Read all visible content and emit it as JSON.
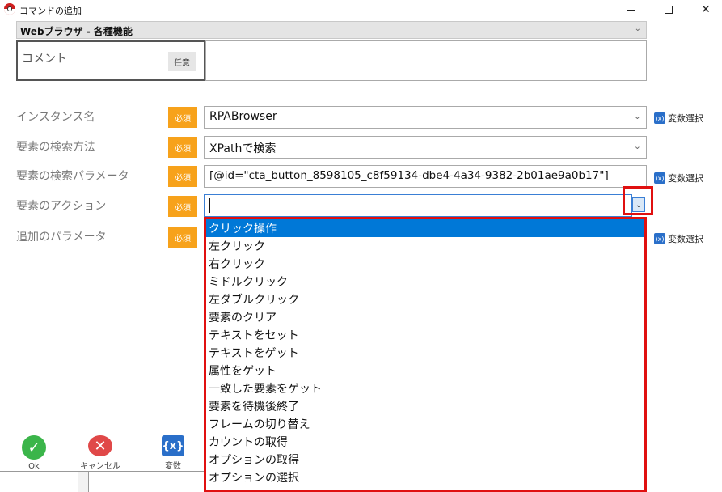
{
  "window": {
    "title": "コマンドの追加"
  },
  "category": {
    "value": "Webブラウザ - 各種機能"
  },
  "comment": {
    "label": "コメント",
    "badge": "任意",
    "value": ""
  },
  "badges": {
    "required": "必須"
  },
  "fields": {
    "instance": {
      "label": "インスタンス名",
      "value": "RPABrowser"
    },
    "search_method": {
      "label": "要素の検索方法",
      "value": "XPathで検索"
    },
    "search_param": {
      "label": "要素の検索パラメータ",
      "value": "[@id=\"cta_button_8598105_c8f59134-dbe4-4a34-9382-2b01ae9a0b17\"]"
    },
    "action": {
      "label": "要素のアクション",
      "value": ""
    },
    "extra_param": {
      "label": "追加のパラメータ"
    }
  },
  "var_select": {
    "label": "変数選択",
    "icon": "variable-icon"
  },
  "dropdown_options": [
    "クリック操作",
    "左クリック",
    "右クリック",
    "ミドルクリック",
    "左ダブルクリック",
    "要素のクリア",
    "テキストをセット",
    "テキストをゲット",
    "属性をゲット",
    "一致した要素をゲット",
    "要素を待機後終了",
    "フレームの切り替え",
    "カウントの取得",
    "オプションの取得",
    "オプションの選択"
  ],
  "buttons": {
    "ok": "Ok",
    "cancel": "キャンセル",
    "variable": "変数",
    "variable_icon_text": "{x}"
  },
  "colors": {
    "required_badge": "#f7a21b",
    "selection": "#0078d7",
    "highlight": "#e01010",
    "ok": "#3bb54a",
    "cancel": "#e04848",
    "variable": "#2a6fc9"
  }
}
